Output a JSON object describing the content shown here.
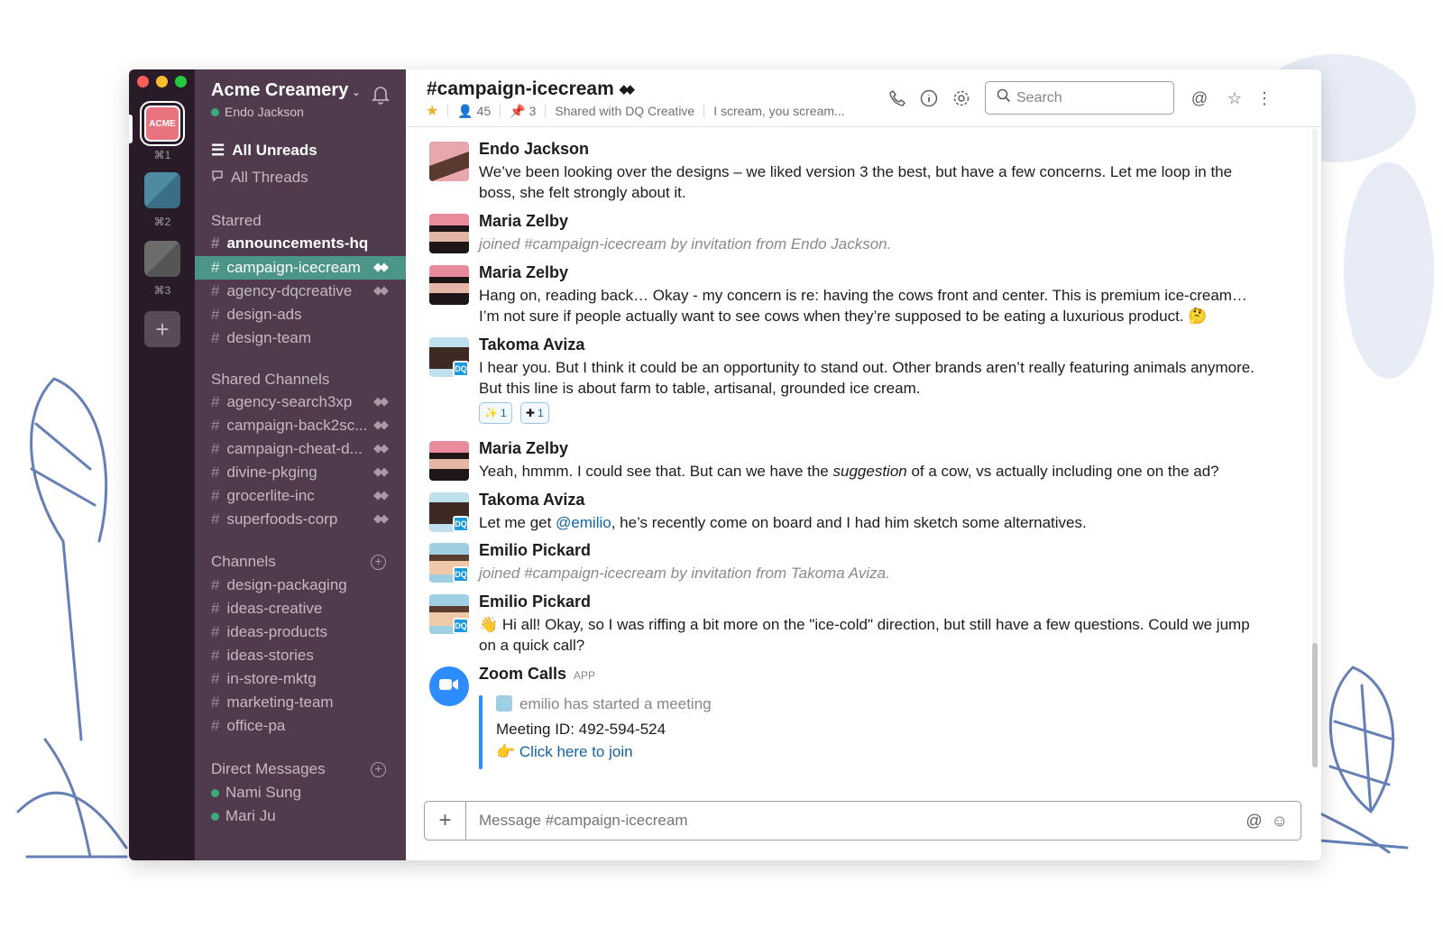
{
  "workspace": {
    "name": "Acme Creamery",
    "user": "Endo Jackson",
    "team_logo_text": "ACME",
    "team_keys": [
      "⌘1",
      "⌘2",
      "⌘3"
    ]
  },
  "nav": {
    "all_unreads": "All Unreads",
    "all_threads": "All Threads"
  },
  "sections": {
    "starred": "Starred",
    "shared": "Shared Channels",
    "channels": "Channels",
    "dms": "Direct Messages"
  },
  "starred_channels": [
    {
      "name": "announcements-hq"
    },
    {
      "name": "campaign-icecream"
    },
    {
      "name": "agency-dqcreative"
    },
    {
      "name": "design-ads"
    },
    {
      "name": "design-team"
    }
  ],
  "shared_channels": [
    {
      "name": "agency-search3xp"
    },
    {
      "name": "campaign-back2sc..."
    },
    {
      "name": "campaign-cheat-d..."
    },
    {
      "name": "divine-pkging"
    },
    {
      "name": "grocerlite-inc"
    },
    {
      "name": "superfoods-corp"
    }
  ],
  "channels": [
    {
      "name": "design-packaging"
    },
    {
      "name": "ideas-creative"
    },
    {
      "name": "ideas-products"
    },
    {
      "name": "ideas-stories"
    },
    {
      "name": "in-store-mktg"
    },
    {
      "name": "marketing-team"
    },
    {
      "name": "office-pa"
    }
  ],
  "direct_messages": [
    {
      "name": "Nami Sung"
    },
    {
      "name": "Mari Ju"
    }
  ],
  "header": {
    "channel_title": "#campaign-icecream",
    "member_count": "45",
    "pinned_count": "3",
    "shared_with": "Shared with DQ Creative",
    "topic": "I scream, you scream...",
    "search_placeholder": "Search"
  },
  "messages": [
    {
      "author": "Endo Jackson",
      "text": "We’ve been looking over the designs – we liked version 3 the best, but have a few concerns. Let me loop in the boss, she felt strongly about it."
    },
    {
      "author": "Maria Zelby",
      "text": "joined #campaign-icecream by invitation from Endo Jackson."
    },
    {
      "author": "Maria Zelby",
      "text": "Hang on, reading back… Okay - my concern is re: having the cows front and center. This is premium ice-cream… I’m not sure if people actually want to see cows when they’re supposed to be eating a luxurious product. 🤔"
    },
    {
      "author": "Takoma Aviza",
      "text": "I hear you. But I think it could be an opportunity to stand out. Other brands aren’t really featuring animals anymore. But this line is about farm to table, artisanal, grounded ice cream."
    },
    {
      "author": "Maria Zelby",
      "text_before": "Yeah, hmmm. I could see that. But can we have the ",
      "text_em": "suggestion",
      "text_after": " of a cow, vs actually including one on the ad?"
    },
    {
      "author": "Takoma Aviza",
      "text_before": "Let me get ",
      "mention": "@emilio",
      "text_after": ", he’s recently come on board and I had him sketch some alternatives."
    },
    {
      "author": "Emilio Pickard",
      "text": "joined #campaign-icecream by invitation from Takoma Aviza."
    },
    {
      "author": "Emilio Pickard",
      "text": "👋  Hi all! Okay, so I was riffing a bit more on the \"ice-cold\" direction, but still have a few questions. Could we jump on a quick call?"
    },
    {
      "author": "Zoom Calls",
      "app_tag": "APP",
      "attachment": {
        "started": "emilio has started a meeting",
        "meeting_id": "Meeting ID: 492-594-524",
        "join": "👉 Click here to join"
      }
    }
  ],
  "reactions": [
    {
      "emoji": "✨",
      "count": "1"
    },
    {
      "emoji": "✚",
      "count": "1"
    }
  ],
  "dq_badge": "DQ",
  "composer": {
    "placeholder": "Message #campaign-icecream"
  },
  "colors": {
    "team_bar": "#2a1b29",
    "sidebar": "#4f3a4e",
    "active_channel": "#4c9689",
    "presence": "#3daa7d",
    "link": "#1264a3",
    "zoom": "#2d8cff"
  }
}
